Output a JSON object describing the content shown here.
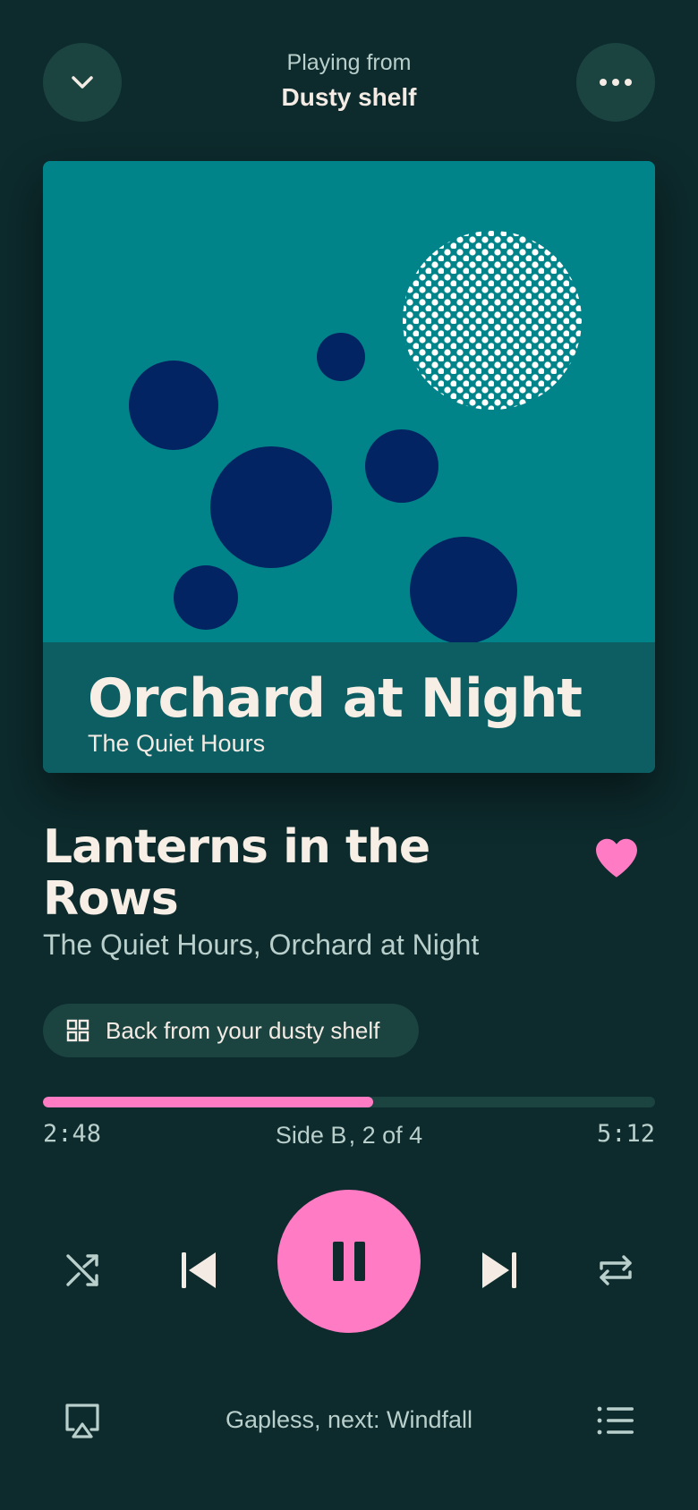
{
  "header": {
    "playing_from_label": "Playing from",
    "source_name": "Dusty shelf",
    "left_icon": "chevron-down-icon",
    "right_icon": "more-icon"
  },
  "artwork": {
    "album_title": "Orchard at Night",
    "artist": "The Quiet Hours",
    "background_color": "#008489",
    "band_color": "#0d5e62",
    "circle_color": "#032462"
  },
  "track": {
    "title": "Lanterns in the Rows",
    "subtitle": "The Quiet Hours, Orchard at Night",
    "liked": true
  },
  "chip": {
    "icon": "grid-icon",
    "label": "Back from your dusty shelf"
  },
  "progress": {
    "elapsed": "2:48",
    "total": "5:12",
    "fraction": 0.54,
    "side_label": "Side B , 2 of 4"
  },
  "controls": {
    "shuffle_icon": "shuffle-icon",
    "previous_icon": "skip-previous-icon",
    "play_state_icon": "pause-icon",
    "next_icon": "skip-next-icon",
    "repeat_icon": "repeat-icon"
  },
  "footer": {
    "cast_icon": "airplay-icon",
    "next_up_text": "Gapless, next: Windfall",
    "queue_icon": "queue-list-icon"
  },
  "colors": {
    "background": "#0d2a2c",
    "accent": "#ff7bc4",
    "button_bg": "#1b4441",
    "text_primary": "#f4ece4",
    "text_secondary": "#b9cfcc"
  }
}
